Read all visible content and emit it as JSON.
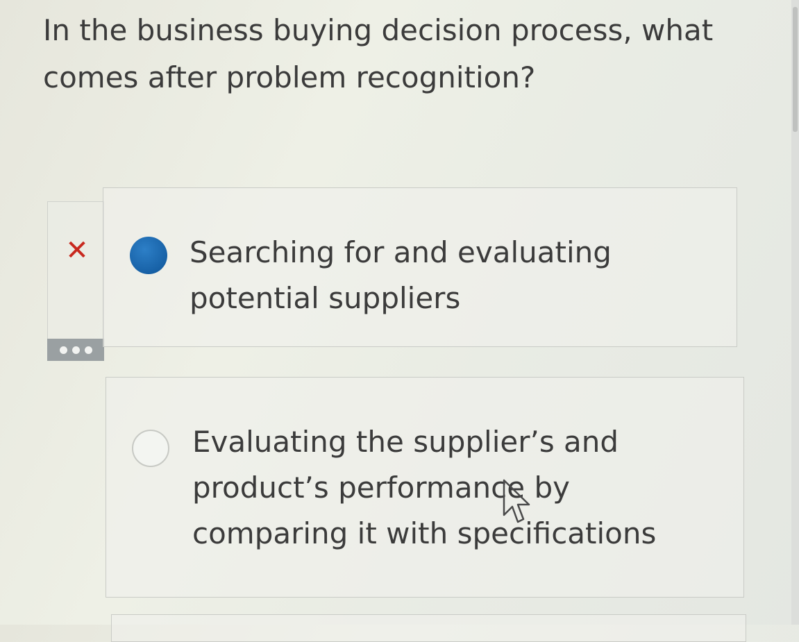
{
  "question": {
    "text": "In the business buying decision process, what comes after problem recognition?"
  },
  "options": [
    {
      "label": "Searching for and evaluating potential suppliers",
      "selected": true,
      "status": "incorrect",
      "status_icon": "x-mark-icon",
      "status_color": "#c8281e"
    },
    {
      "label": "Evaluating the supplier’s and product’s performance by comparing it with specifications",
      "selected": false
    }
  ],
  "more_menu": {
    "icon": "more-dots-icon"
  },
  "colors": {
    "selected_radio": "#1761a6",
    "incorrect_mark": "#c8281e",
    "more_button_bg": "#9aa0a2"
  }
}
